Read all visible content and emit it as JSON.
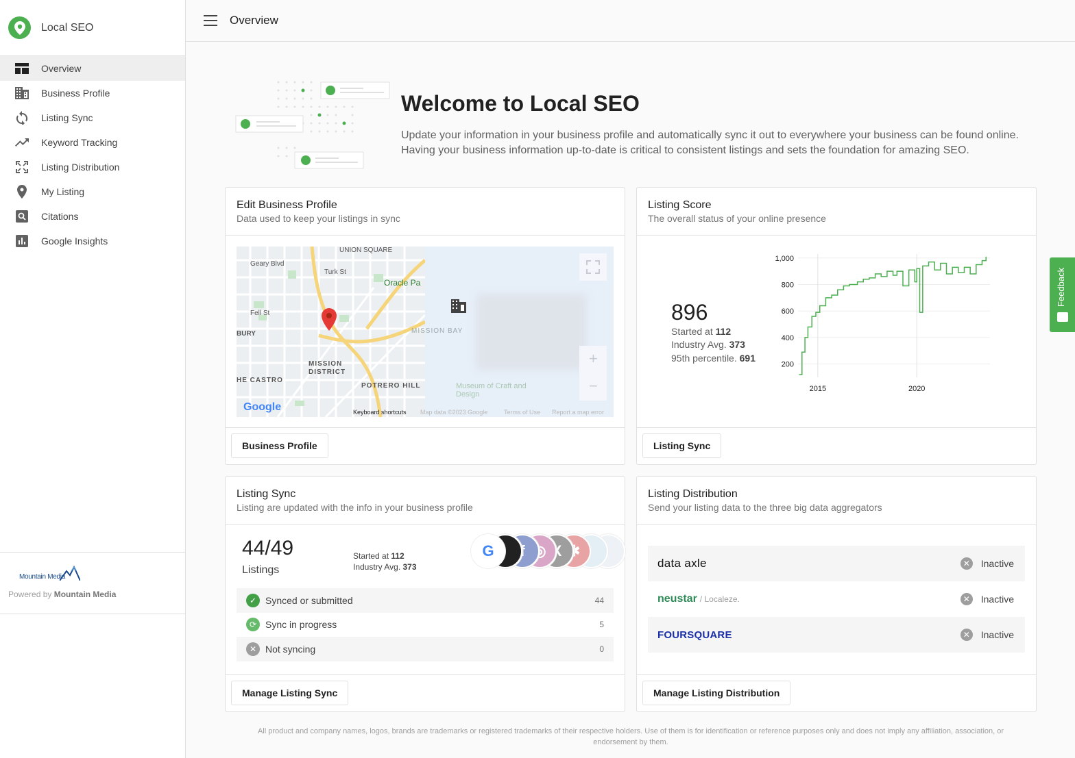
{
  "app": {
    "name": "Local SEO"
  },
  "topbar": {
    "title": "Overview"
  },
  "sidebar": {
    "items": [
      {
        "label": "Overview",
        "icon": "dashboard-icon",
        "active": true
      },
      {
        "label": "Business Profile",
        "icon": "building-icon"
      },
      {
        "label": "Listing Sync",
        "icon": "sync-icon"
      },
      {
        "label": "Keyword Tracking",
        "icon": "trending-up-icon"
      },
      {
        "label": "Listing Distribution",
        "icon": "expand-icon"
      },
      {
        "label": "My Listing",
        "icon": "location-pin-icon"
      },
      {
        "label": "Citations",
        "icon": "search-box-icon"
      },
      {
        "label": "Google Insights",
        "icon": "bar-chart-icon"
      }
    ],
    "footer": {
      "logo_text": "Mountain Media",
      "powered_prefix": "Powered by",
      "powered_name": "Mountain Media"
    }
  },
  "welcome": {
    "title": "Welcome to Local SEO",
    "text": "Update your information in your business profile and automatically sync it out to everywhere your business can be found online. Having your business information up-to-date is critical to consistent listings and sets the foundation for amazing SEO."
  },
  "edit_profile": {
    "title": "Edit Business Profile",
    "subtitle": "Data used to keep your listings in sync",
    "button": "Business Profile",
    "map_labels": [
      "UNION SQUARE",
      "Geary Blvd",
      "Turk St",
      "Oracle Pa",
      "Fell St",
      "BURY",
      "MISSION DISTRICT",
      "HE CASTRO",
      "POTRERO HILL",
      "MISSION BAY",
      "Museum of Craft and Design",
      "Keyboard shortcuts",
      "Map data ©2023 Google",
      "Terms of Use",
      "Report a map error",
      "Google"
    ]
  },
  "listing_score": {
    "title": "Listing Score",
    "subtitle": "The overall status of your online presence",
    "button": "Listing Sync",
    "score": "896",
    "started_label": "Started at",
    "started_value": "112",
    "industry_label": "Industry Avg.",
    "industry_value": "373",
    "percentile_label": "95th percentile.",
    "percentile_value": "691"
  },
  "listing_sync": {
    "title": "Listing Sync",
    "subtitle": "Listing are updated with the info in your business profile",
    "button": "Manage Listing Sync",
    "count": "44/49",
    "count_label": "Listings",
    "started_label": "Started at",
    "started_value": "112",
    "industry_label": "Industry Avg.",
    "industry_value": "373",
    "rows": [
      {
        "label": "Synced or submitted",
        "count": "44",
        "color": "#43a047"
      },
      {
        "label": "Sync in progress",
        "count": "5",
        "color": "#66bb6a"
      },
      {
        "label": "Not syncing",
        "count": "0",
        "color": "#9e9e9e"
      }
    ],
    "avatars": [
      {
        "letter": "G",
        "color": "#ffffff",
        "fg": "#4285f4"
      },
      {
        "letter": "",
        "color": "#212121",
        "fg": "#ffffff"
      },
      {
        "letter": "f",
        "color": "#8e9ecf",
        "fg": "#ffffff"
      },
      {
        "letter": "◎",
        "color": "#d9a6c8",
        "fg": "#ffffff"
      },
      {
        "letter": "X",
        "color": "#9e9e9e",
        "fg": "#ffffff"
      },
      {
        "letter": "✱",
        "color": "#e8a4a4",
        "fg": "#ffffff"
      },
      {
        "letter": "",
        "color": "#e3eef5",
        "fg": "#9fc5e0"
      },
      {
        "letter": "",
        "color": "#eef2f7",
        "fg": "#b0c4de"
      }
    ]
  },
  "listing_distribution": {
    "title": "Listing Distribution",
    "subtitle": "Send your listing data to the three big data aggregators",
    "button": "Manage Listing Distribution",
    "rows": [
      {
        "name": "data axle",
        "status": "Inactive"
      },
      {
        "name": "neustar",
        "name_suffix": "/ Localeze.",
        "status": "Inactive"
      },
      {
        "name": "FOURSQUARE",
        "status": "Inactive"
      }
    ]
  },
  "disclaimer": "All product and company names, logos, brands are trademarks or registered trademarks of their respective holders. Use of them is for identification or reference purposes only and does not imply any affiliation, association, or endorsement by them.",
  "feedback": {
    "label": "Feedback"
  },
  "chart_data": {
    "type": "line",
    "title": "",
    "xlabel": "",
    "ylabel": "",
    "x_ticks": [
      "2015",
      "2020"
    ],
    "y_ticks": [
      200,
      400,
      600,
      800,
      1000
    ],
    "y_tick_labels": [
      "200",
      "400",
      "600",
      "800",
      "1,000"
    ],
    "xlim": [
      2014,
      2023.7
    ],
    "ylim": [
      100,
      1030
    ],
    "grid": true,
    "color": "#4caf50",
    "series": [
      {
        "x": [
          2014.05,
          2014.2,
          2014.35,
          2014.5,
          2014.7,
          2014.9,
          2015.1,
          2015.4,
          2015.7,
          2016.0,
          2016.3,
          2016.6,
          2017.0,
          2017.3,
          2017.6,
          2017.9,
          2018.2,
          2018.5,
          2018.8,
          2019.0,
          2019.3,
          2019.6,
          2019.9,
          2020.0,
          2020.15,
          2020.3,
          2020.6,
          2020.9,
          2021.2,
          2021.5,
          2021.8,
          2022.1,
          2022.4,
          2022.7,
          2023.0,
          2023.3,
          2023.5
        ],
        "y": [
          120,
          290,
          400,
          480,
          560,
          590,
          640,
          700,
          720,
          760,
          790,
          800,
          820,
          840,
          850,
          880,
          860,
          900,
          870,
          900,
          790,
          910,
          820,
          920,
          590,
          940,
          970,
          910,
          960,
          880,
          930,
          890,
          930,
          880,
          950,
          980,
          1010
        ]
      }
    ]
  }
}
